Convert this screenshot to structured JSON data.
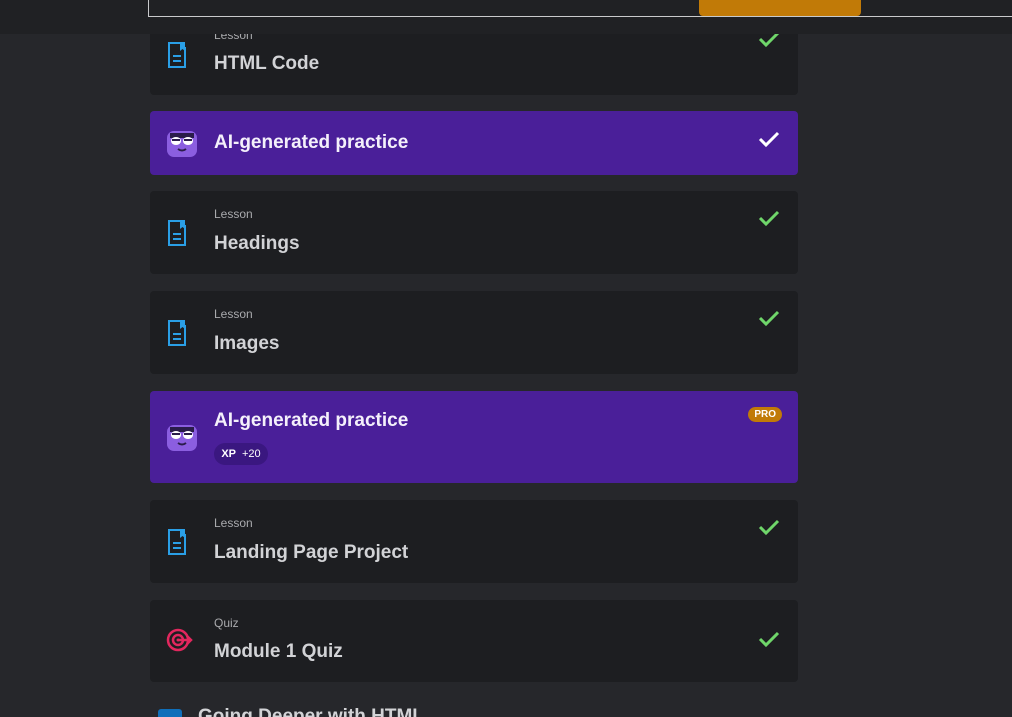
{
  "items": [
    {
      "type": "Lesson",
      "title": "HTML Code",
      "completed": true
    },
    {
      "type": "",
      "title": "AI-generated practice",
      "completed": true
    },
    {
      "type": "Lesson",
      "title": "Headings",
      "completed": true
    },
    {
      "type": "Lesson",
      "title": "Images",
      "completed": true
    },
    {
      "type": "",
      "title": "AI-generated practice",
      "badge": "PRO",
      "xp_label": "XP",
      "xp_value": "+20"
    },
    {
      "type": "Lesson",
      "title": "Landing Page Project",
      "completed": true
    },
    {
      "type": "Quiz",
      "title": "Module 1 Quiz",
      "completed": true
    }
  ],
  "next_module": {
    "title": "Going Deeper with HTML"
  },
  "colors": {
    "accent_purple": "#4a1f99",
    "check_green": "#6fd66a",
    "lesson_icon": "#2a9fe6",
    "quiz_icon": "#e2275e",
    "pro_orange": "#c17a07"
  }
}
